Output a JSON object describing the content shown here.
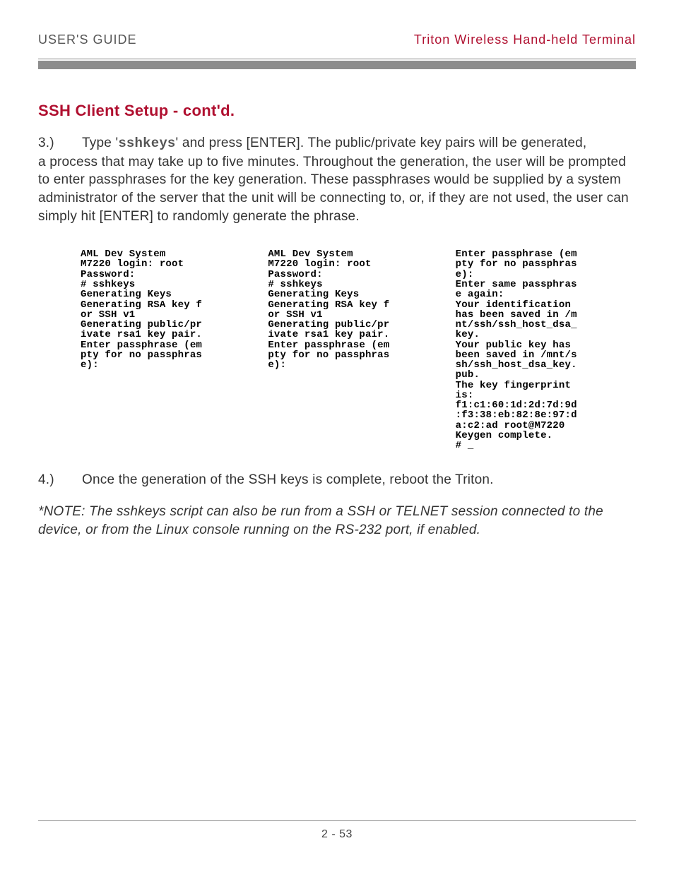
{
  "header": {
    "left": "USER'S GUIDE",
    "right": "Triton Wireless Hand-held Terminal"
  },
  "section_title": "SSH Client Setup - cont'd.",
  "step3": {
    "num": "3.)",
    "pre": "Type '",
    "cmd": "sshkeys",
    "post": "' and press [ENTER]. The public/private key pairs will be generated,",
    "rest": "a process that may take up to five minutes. Throughout the generation, the user will be prompted to enter passphrases for the key generation. These passphrases would be supplied by a system administrator of the server that the unit will be connecting to, or, if they are not used, the user can simply hit [ENTER] to randomly generate the phrase."
  },
  "screens": {
    "s1": "AML Dev System\nM7220 login: root\nPassword:\n# sshkeys\nGenerating Keys\nGenerating RSA key f\nor SSH v1\nGenerating public/pr\nivate rsa1 key pair.\nEnter passphrase (em\npty for no passphras\ne):",
    "s2": "AML Dev System\nM7220 login: root\nPassword:\n# sshkeys\nGenerating Keys\nGenerating RSA key f\nor SSH v1\nGenerating public/pr\nivate rsa1 key pair.\nEnter passphrase (em\npty for no passphras\ne):",
    "s3": "Enter passphrase (em\npty for no passphras\ne):\nEnter same passphras\ne again:\nYour identification\nhas been saved in /m\nnt/ssh/ssh_host_dsa_\nkey.\nYour public key has\nbeen saved in /mnt/s\nsh/ssh_host_dsa_key.\npub.\nThe key fingerprint\nis:\nf1:c1:60:1d:2d:7d:9d\n:f3:38:eb:82:8e:97:d\na:c2:ad root@M7220\nKeygen complete.\n# _"
  },
  "step4": {
    "num": "4.)",
    "text": "Once the generation of the SSH keys is complete, reboot the Triton."
  },
  "note": "*NOTE: The sshkeys script can also be run from a SSH or TELNET session connected to the device, or from the Linux console running on the RS-232 port, if enabled.",
  "footer": "2 - 53"
}
